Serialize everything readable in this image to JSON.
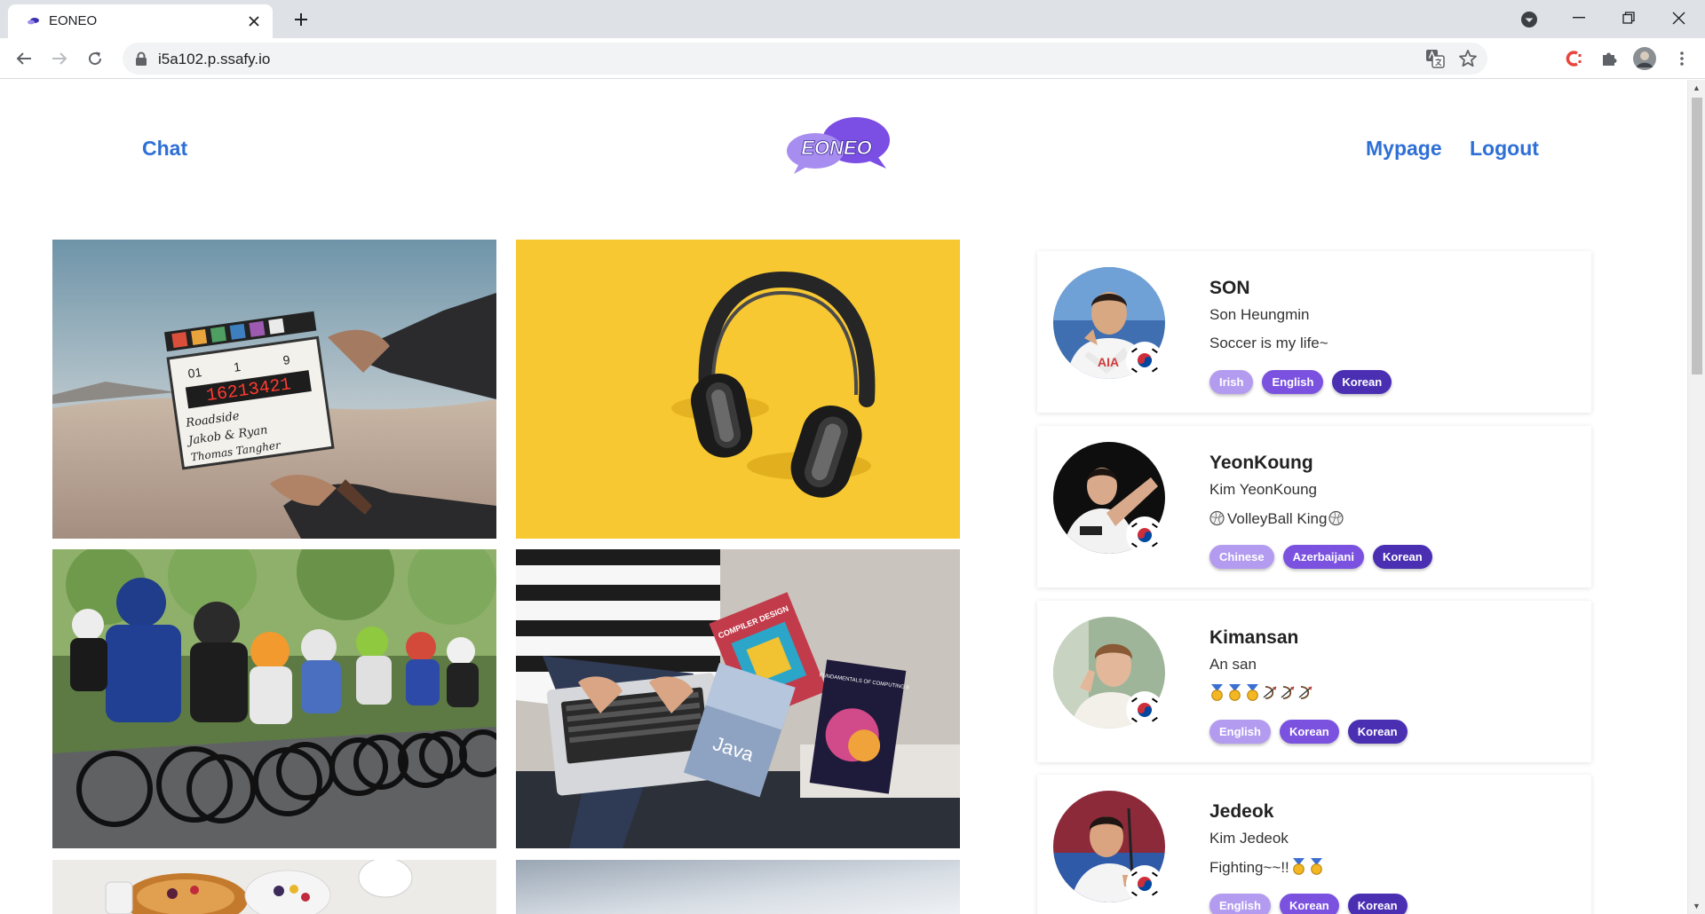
{
  "browser": {
    "tab_title": "EONEO",
    "url": "i5a102.p.ssafy.io"
  },
  "nav": {
    "chat": "Chat",
    "logo_text": "EONEO",
    "mypage": "Mypage",
    "logout": "Logout"
  },
  "gallery": [
    {
      "name": "clapperboard",
      "slate": {
        "timecode": "16213421",
        "scene": "01",
        "take": "1",
        "roll": "9",
        "line1": "Roadside",
        "line2": "Jakob & Ryan",
        "line3": "Thomas Tangher"
      }
    },
    {
      "name": "headphones"
    },
    {
      "name": "cycling"
    },
    {
      "name": "laptop-books",
      "book_text": "Java",
      "book2_text": "COMPILER DESIGN",
      "book3_text": "FUNDAMENTALS OF COMPUTING II"
    },
    {
      "name": "breakfast"
    },
    {
      "name": "gradient"
    }
  ],
  "users": [
    {
      "nickname": "SON",
      "name": "Son Heungmin",
      "bio": "Soccer is my life~",
      "tags": [
        "Irish",
        "English",
        "Korean"
      ]
    },
    {
      "nickname": "YeonKoung",
      "name": "Kim YeonKoung",
      "bio": "VolleyBall King",
      "tags": [
        "Chinese",
        "Azerbaijani",
        "Korean"
      ]
    },
    {
      "nickname": "Kimansan",
      "name": "An san",
      "bio": "",
      "tags": [
        "English",
        "Korean",
        "Korean"
      ]
    },
    {
      "nickname": "Jedeok",
      "name": "Kim Jedeok",
      "bio": "Fighting~~!!",
      "tags": [
        "English",
        "Korean",
        "Korean"
      ]
    }
  ],
  "colors": {
    "link": "#2e6fd6",
    "tag_light": "#b39cf0",
    "tag_mid": "#7b52e0",
    "tag_dark": "#4a2fb3",
    "logo_purple": "#7b4ee4"
  }
}
